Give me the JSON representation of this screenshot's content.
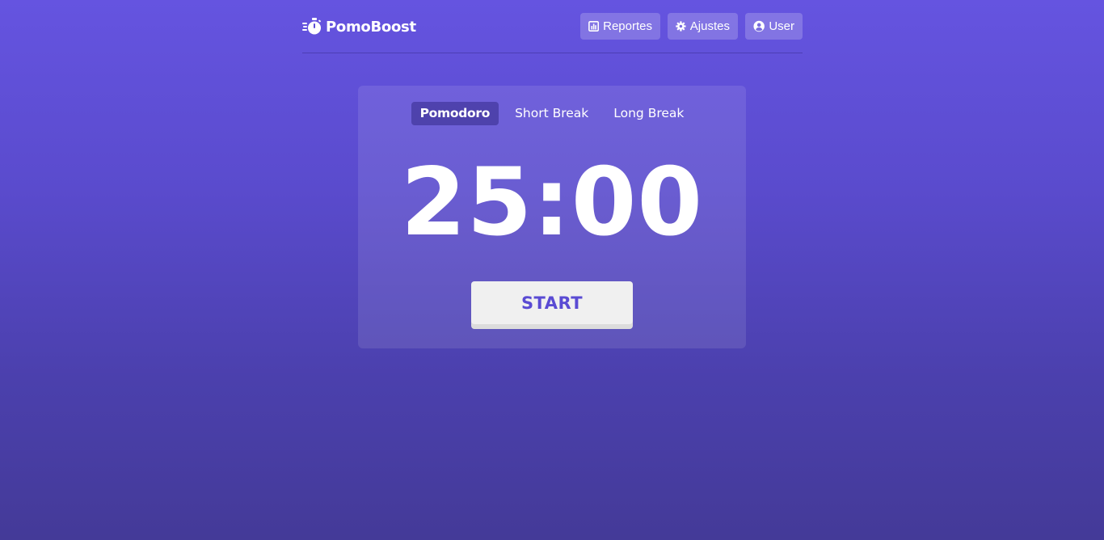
{
  "brand": {
    "name": "PomoBoost",
    "icon": "stopwatch-icon"
  },
  "nav": {
    "reports_label": "Reportes",
    "reports_icon": "bar-chart-icon",
    "settings_label": "Ajustes",
    "settings_icon": "gear-icon",
    "user_label": "User",
    "user_icon": "user-circle-icon"
  },
  "timer": {
    "modes": [
      {
        "label": "Pomodoro",
        "active": true
      },
      {
        "label": "Short Break",
        "active": false
      },
      {
        "label": "Long Break",
        "active": false
      }
    ],
    "time": "25:00",
    "start_label": "START"
  },
  "colors": {
    "background_top": "#6554e0",
    "background_bottom": "#443a98",
    "accent_text": "#5a4bd3",
    "button_bg": "#f0f0f0"
  }
}
